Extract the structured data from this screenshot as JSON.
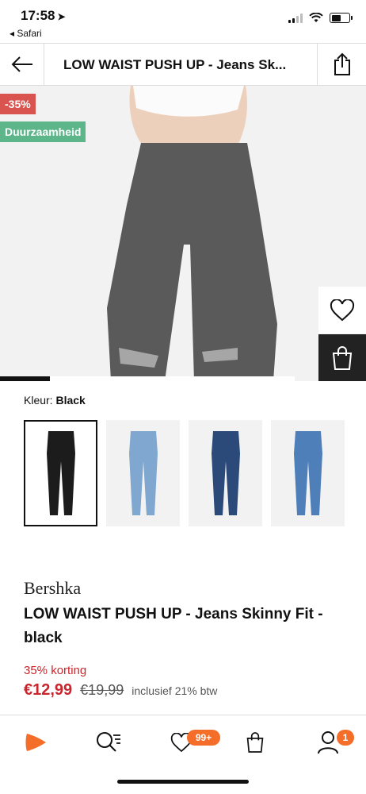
{
  "status_bar": {
    "time": "17:58",
    "back_app": "◂ Safari"
  },
  "header": {
    "title": "LOW WAIST PUSH UP - Jeans Sk..."
  },
  "hero": {
    "discount_badge": "-35%",
    "sustainability_badge": "Duurzaamheid",
    "gallery_progress": 0.17
  },
  "color_selector": {
    "label": "Kleur:",
    "selected": "Black",
    "swatches": [
      "black",
      "light-blue",
      "dark-blue",
      "mid-blue"
    ]
  },
  "product": {
    "brand": "Bershka",
    "name": "LOW WAIST PUSH UP - Jeans Skinny Fit - black",
    "discount_text": "35% korting",
    "price": "€12,99",
    "old_price": "€19,99",
    "vat_note": "inclusief 21% btw"
  },
  "tabbar": {
    "wishlist_count": "99+",
    "account_count": "1"
  },
  "colors": {
    "accent": "#f46e2a",
    "sale": "#c9252c",
    "discount_badge": "#d9534f",
    "sustain_badge": "#5cb68a"
  }
}
